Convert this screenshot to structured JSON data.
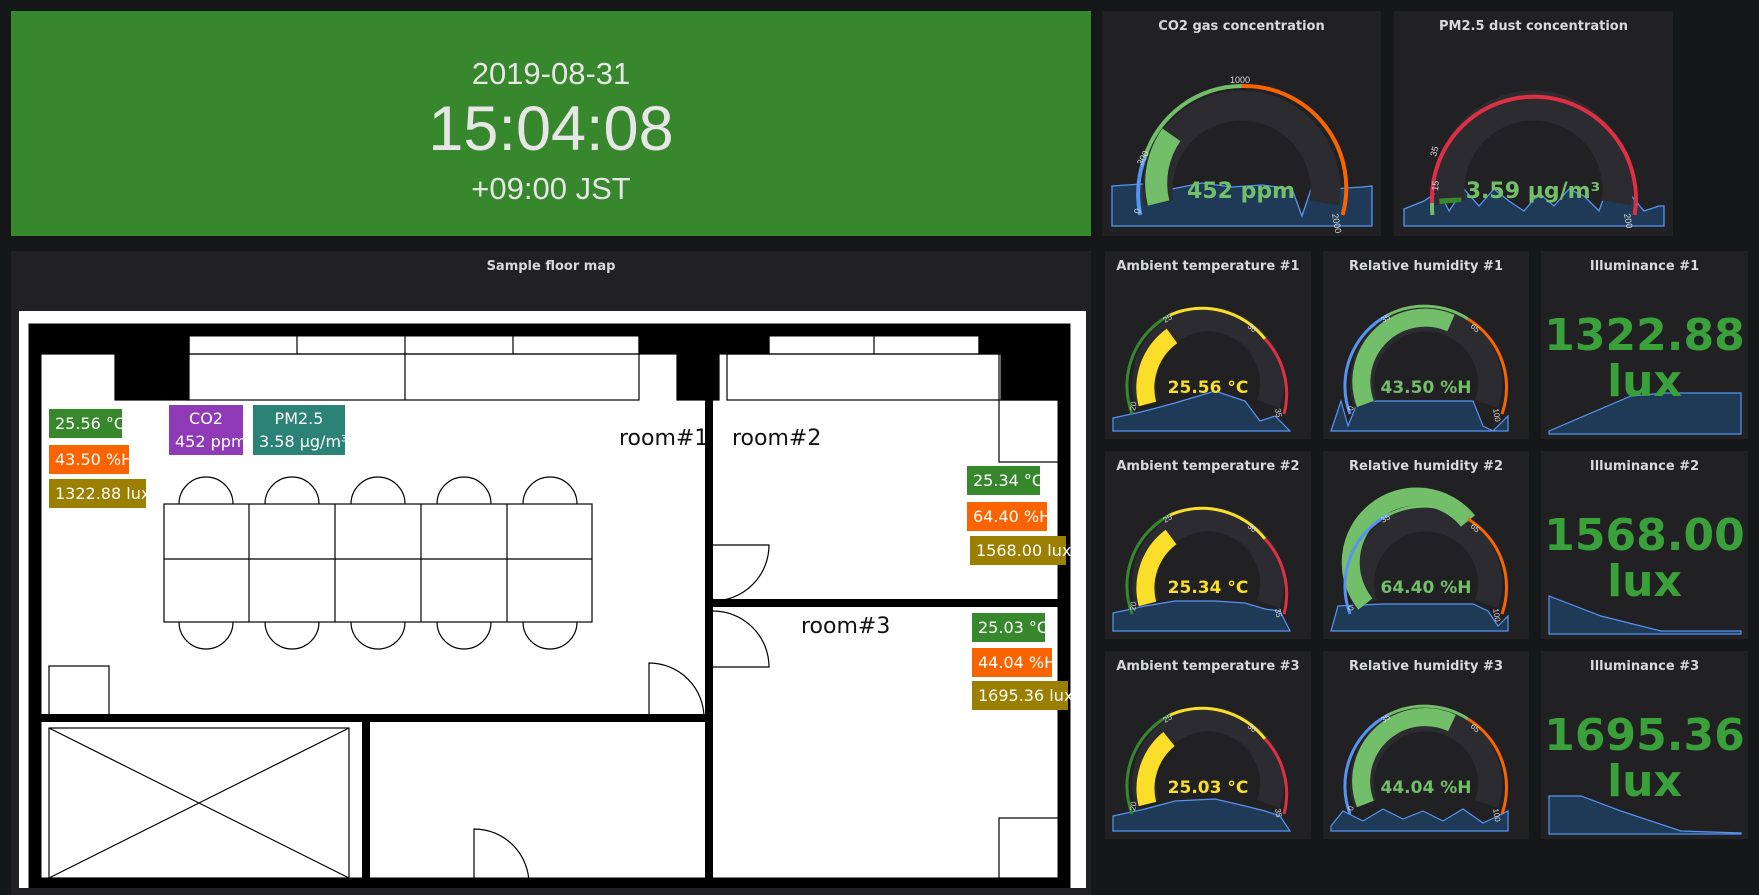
{
  "clock": {
    "date": "2019-08-31",
    "time": "15:04:08",
    "timezone": "+09:00 JST"
  },
  "co2_panel": {
    "title": "CO2 gas concentration",
    "value": "452 ppm",
    "reading": 452,
    "ticks": [
      "0",
      "300",
      "1000",
      "2000"
    ],
    "min": 0,
    "max": 2000
  },
  "pm_panel": {
    "title": "PM2.5 dust concentration",
    "value": "3.59 µg/m³",
    "reading": 3.59,
    "ticks": [
      "15",
      "35",
      "200"
    ],
    "min": 0,
    "max": 200
  },
  "floor_map": {
    "title": "Sample floor map",
    "rooms": [
      "room#1",
      "room#2",
      "room#3"
    ],
    "room1": {
      "temp": "25.56 °C",
      "hum": "43.50 %H",
      "lux": "1322.88 lux",
      "co2_label": "CO2",
      "co2_value": "452 ppm",
      "pm_label": "PM2.5",
      "pm_value": "3.58 µg/m³"
    },
    "room2": {
      "temp": "25.34 °C",
      "hum": "64.40 %H",
      "lux": "1568.00 lux"
    },
    "room3": {
      "temp": "25.03 °C",
      "hum": "44.04 %H",
      "lux": "1695.36 lux"
    }
  },
  "temp_panels": [
    {
      "title": "Ambient temperature #1",
      "value": "25.56 °C",
      "reading": 25.56,
      "ticks": [
        "20",
        "25",
        "30",
        "35"
      ]
    },
    {
      "title": "Ambient temperature #2",
      "value": "25.34 °C",
      "reading": 25.34,
      "ticks": [
        "20",
        "25",
        "30",
        "35"
      ]
    },
    {
      "title": "Ambient temperature #3",
      "value": "25.03 °C",
      "reading": 25.03,
      "ticks": [
        "20",
        "25",
        "30",
        "35"
      ]
    }
  ],
  "hum_panels": [
    {
      "title": "Relative humidity #1",
      "value": "43.50 %H",
      "reading": 43.5,
      "ticks": [
        "0",
        "35",
        "65",
        "100"
      ]
    },
    {
      "title": "Relative humidity #2",
      "value": "64.40 %H",
      "reading": 64.4,
      "ticks": [
        "0",
        "35",
        "65",
        "100"
      ]
    },
    {
      "title": "Relative humidity #3",
      "value": "44.04 %H",
      "reading": 44.04,
      "ticks": [
        "0",
        "35",
        "65",
        "100"
      ]
    }
  ],
  "lux_panels": [
    {
      "title": "Illuminance #1",
      "value": "1322.88",
      "unit": "lux"
    },
    {
      "title": "Illuminance #2",
      "value": "1568.00",
      "unit": "lux"
    },
    {
      "title": "Illuminance #3",
      "value": "1695.36",
      "unit": "lux"
    }
  ],
  "colors": {
    "green": "#37872d",
    "gauge_green": "#73bf69",
    "yellow": "#fade2a",
    "orange": "#fa6400",
    "red": "#e02f44",
    "blue": "#5794f2",
    "purple": "#8f3bb8",
    "teal": "#2b8277",
    "olive": "#9b7f00"
  }
}
